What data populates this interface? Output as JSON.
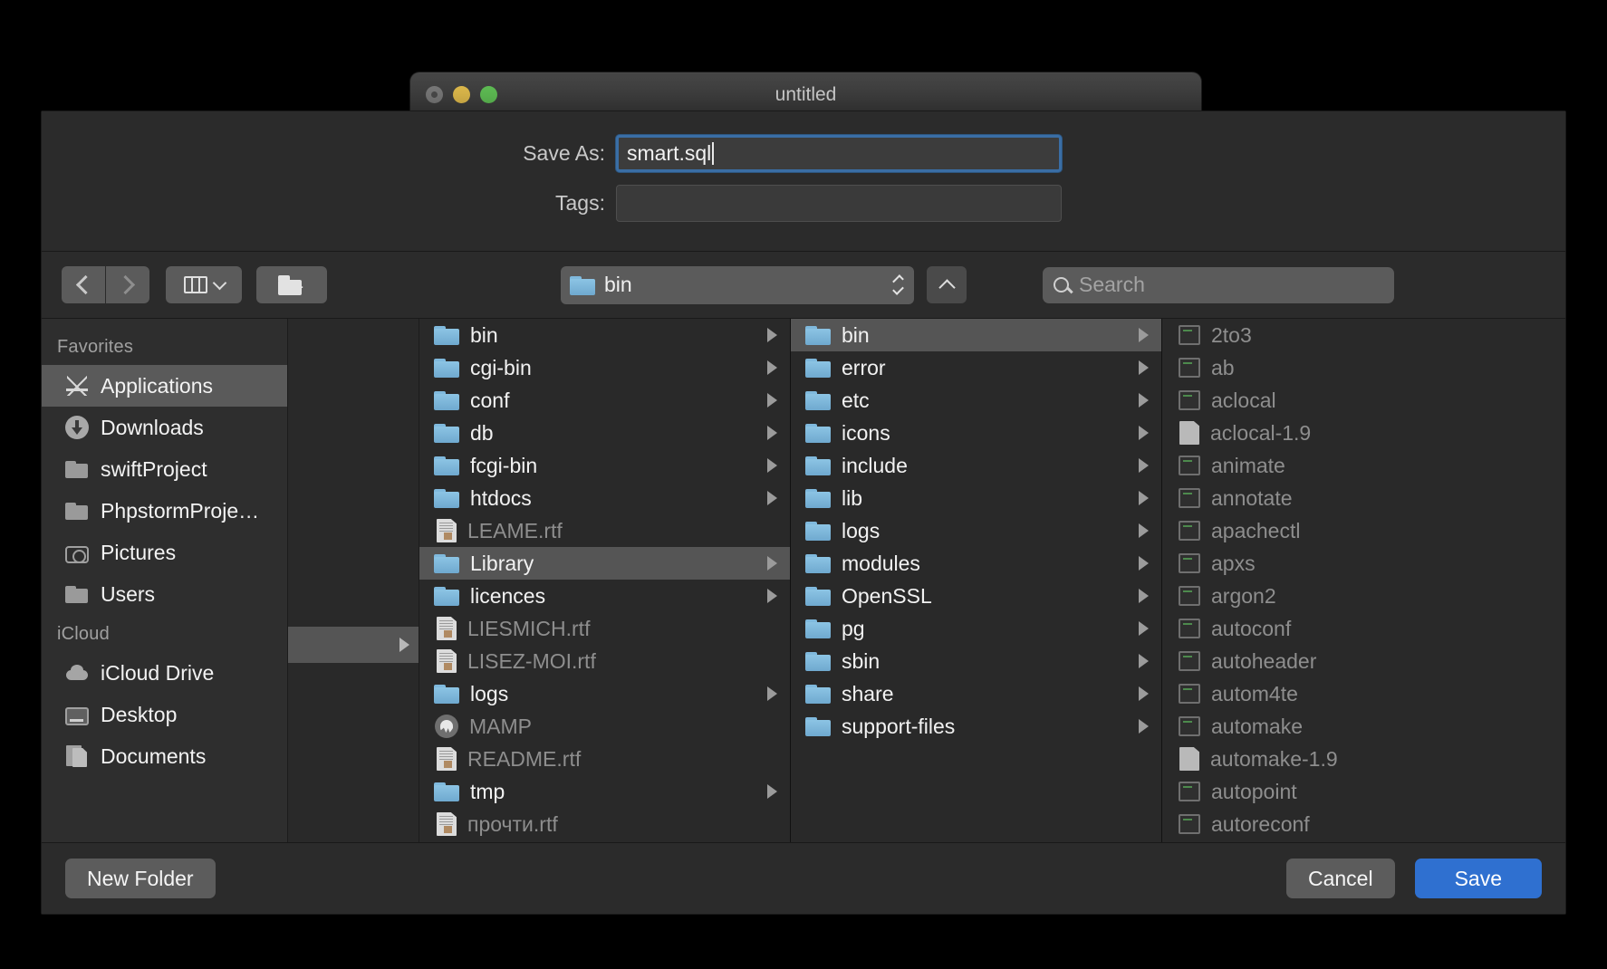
{
  "parent_window": {
    "title": "untitled"
  },
  "form": {
    "save_as_label": "Save As:",
    "filename_value": "smart.sql",
    "tags_label": "Tags:",
    "tags_value": ""
  },
  "toolbar": {
    "back_icon": "chevron-left-icon",
    "forward_icon": "chevron-right-icon",
    "view_icon": "column-view-icon",
    "new_folder_icon": "new-folder-icon",
    "path_label": "bin",
    "up_icon": "chevron-up-icon",
    "search_placeholder": "Search",
    "search_value": "",
    "search_icon": "search-icon"
  },
  "sidebar": {
    "sections": [
      {
        "title": "Favorites",
        "items": [
          {
            "label": "Applications",
            "icon": "app-store-icon",
            "selected": true
          },
          {
            "label": "Downloads",
            "icon": "download-icon",
            "selected": false
          },
          {
            "label": "swiftProject",
            "icon": "folder-icon",
            "selected": false
          },
          {
            "label": "PhpstormProje…",
            "icon": "folder-icon",
            "selected": false
          },
          {
            "label": "Pictures",
            "icon": "camera-icon",
            "selected": false
          },
          {
            "label": "Users",
            "icon": "folder-icon",
            "selected": false
          }
        ]
      },
      {
        "title": "iCloud",
        "items": [
          {
            "label": "iCloud Drive",
            "icon": "cloud-icon",
            "selected": false
          },
          {
            "label": "Desktop",
            "icon": "desktop-icon",
            "selected": false
          },
          {
            "label": "Documents",
            "icon": "documents-icon",
            "selected": false
          }
        ]
      }
    ]
  },
  "columns": [
    {
      "name": "column-1",
      "items": [
        {
          "label": "bin",
          "icon": "folder-icon",
          "type": "folder",
          "arrow": true,
          "dim": false,
          "selected": false
        },
        {
          "label": "cgi-bin",
          "icon": "folder-icon",
          "type": "folder",
          "arrow": true,
          "dim": false,
          "selected": false
        },
        {
          "label": "conf",
          "icon": "folder-icon",
          "type": "folder",
          "arrow": true,
          "dim": false,
          "selected": false
        },
        {
          "label": "db",
          "icon": "folder-icon",
          "type": "folder",
          "arrow": true,
          "dim": false,
          "selected": false
        },
        {
          "label": "fcgi-bin",
          "icon": "folder-icon",
          "type": "folder",
          "arrow": true,
          "dim": false,
          "selected": false
        },
        {
          "label": "htdocs",
          "icon": "folder-icon",
          "type": "folder",
          "arrow": true,
          "dim": false,
          "selected": false
        },
        {
          "label": "LEAME.rtf",
          "icon": "rtf-file-icon",
          "type": "rtf",
          "arrow": false,
          "dim": true,
          "selected": false
        },
        {
          "label": "Library",
          "icon": "folder-icon",
          "type": "folder",
          "arrow": true,
          "dim": false,
          "selected": true
        },
        {
          "label": "licences",
          "icon": "folder-icon",
          "type": "folder",
          "arrow": true,
          "dim": false,
          "selected": false
        },
        {
          "label": "LIESMICH.rtf",
          "icon": "rtf-file-icon",
          "type": "rtf",
          "arrow": false,
          "dim": true,
          "selected": false
        },
        {
          "label": "LISEZ-MOI.rtf",
          "icon": "rtf-file-icon",
          "type": "rtf",
          "arrow": false,
          "dim": true,
          "selected": false
        },
        {
          "label": "logs",
          "icon": "folder-icon",
          "type": "folder",
          "arrow": true,
          "dim": false,
          "selected": false
        },
        {
          "label": "MAMP",
          "icon": "mamp-app-icon",
          "type": "mamp",
          "arrow": false,
          "dim": true,
          "selected": false
        },
        {
          "label": "README.rtf",
          "icon": "rtf-file-icon",
          "type": "rtf",
          "arrow": false,
          "dim": true,
          "selected": false
        },
        {
          "label": "tmp",
          "icon": "folder-icon",
          "type": "folder",
          "arrow": true,
          "dim": false,
          "selected": false
        },
        {
          "label": "прочти.rtf",
          "icon": "rtf-file-icon",
          "type": "rtf",
          "arrow": false,
          "dim": true,
          "selected": false
        }
      ]
    },
    {
      "name": "column-2",
      "items": [
        {
          "label": "bin",
          "icon": "folder-icon",
          "type": "folder",
          "arrow": true,
          "dim": false,
          "selected": true
        },
        {
          "label": "error",
          "icon": "folder-icon",
          "type": "folder",
          "arrow": true,
          "dim": false,
          "selected": false
        },
        {
          "label": "etc",
          "icon": "folder-icon",
          "type": "folder",
          "arrow": true,
          "dim": false,
          "selected": false
        },
        {
          "label": "icons",
          "icon": "folder-icon",
          "type": "folder",
          "arrow": true,
          "dim": false,
          "selected": false
        },
        {
          "label": "include",
          "icon": "folder-icon",
          "type": "folder",
          "arrow": true,
          "dim": false,
          "selected": false
        },
        {
          "label": "lib",
          "icon": "folder-icon",
          "type": "folder",
          "arrow": true,
          "dim": false,
          "selected": false
        },
        {
          "label": "logs",
          "icon": "folder-icon",
          "type": "folder",
          "arrow": true,
          "dim": false,
          "selected": false
        },
        {
          "label": "modules",
          "icon": "folder-icon",
          "type": "folder",
          "arrow": true,
          "dim": false,
          "selected": false
        },
        {
          "label": "OpenSSL",
          "icon": "folder-icon",
          "type": "folder",
          "arrow": true,
          "dim": false,
          "selected": false
        },
        {
          "label": "pg",
          "icon": "folder-icon",
          "type": "folder",
          "arrow": true,
          "dim": false,
          "selected": false
        },
        {
          "label": "sbin",
          "icon": "folder-icon",
          "type": "folder",
          "arrow": true,
          "dim": false,
          "selected": false
        },
        {
          "label": "share",
          "icon": "folder-icon",
          "type": "folder",
          "arrow": true,
          "dim": false,
          "selected": false
        },
        {
          "label": "support-files",
          "icon": "folder-icon",
          "type": "folder",
          "arrow": true,
          "dim": false,
          "selected": false
        }
      ]
    },
    {
      "name": "column-3",
      "items": [
        {
          "label": "2to3",
          "icon": "executable-icon",
          "type": "exec",
          "arrow": false,
          "dim": true,
          "selected": false
        },
        {
          "label": "ab",
          "icon": "executable-icon",
          "type": "exec",
          "arrow": false,
          "dim": true,
          "selected": false
        },
        {
          "label": "aclocal",
          "icon": "executable-icon",
          "type": "exec",
          "arrow": false,
          "dim": true,
          "selected": false
        },
        {
          "label": "aclocal-1.9",
          "icon": "plain-file-icon",
          "type": "plaindoc",
          "arrow": false,
          "dim": true,
          "selected": false
        },
        {
          "label": "animate",
          "icon": "executable-icon",
          "type": "exec",
          "arrow": false,
          "dim": true,
          "selected": false
        },
        {
          "label": "annotate",
          "icon": "executable-icon",
          "type": "exec",
          "arrow": false,
          "dim": true,
          "selected": false
        },
        {
          "label": "apachectl",
          "icon": "executable-icon",
          "type": "exec",
          "arrow": false,
          "dim": true,
          "selected": false
        },
        {
          "label": "apxs",
          "icon": "executable-icon",
          "type": "exec",
          "arrow": false,
          "dim": true,
          "selected": false
        },
        {
          "label": "argon2",
          "icon": "executable-icon",
          "type": "exec",
          "arrow": false,
          "dim": true,
          "selected": false
        },
        {
          "label": "autoconf",
          "icon": "executable-icon",
          "type": "exec",
          "arrow": false,
          "dim": true,
          "selected": false
        },
        {
          "label": "autoheader",
          "icon": "executable-icon",
          "type": "exec",
          "arrow": false,
          "dim": true,
          "selected": false
        },
        {
          "label": "autom4te",
          "icon": "executable-icon",
          "type": "exec",
          "arrow": false,
          "dim": true,
          "selected": false
        },
        {
          "label": "automake",
          "icon": "executable-icon",
          "type": "exec",
          "arrow": false,
          "dim": true,
          "selected": false
        },
        {
          "label": "automake-1.9",
          "icon": "plain-file-icon",
          "type": "plaindoc",
          "arrow": false,
          "dim": true,
          "selected": false
        },
        {
          "label": "autopoint",
          "icon": "executable-icon",
          "type": "exec",
          "arrow": false,
          "dim": true,
          "selected": false
        },
        {
          "label": "autoreconf",
          "icon": "executable-icon",
          "type": "exec",
          "arrow": false,
          "dim": true,
          "selected": false
        }
      ]
    }
  ],
  "footer": {
    "new_folder_label": "New Folder",
    "cancel_label": "Cancel",
    "save_label": "Save"
  },
  "colors": {
    "accent_blue": "#2f70d0",
    "selection_grey": "#555555",
    "folder_blue": "#7fb9dd",
    "focus_ring": "#3a6ea5"
  }
}
